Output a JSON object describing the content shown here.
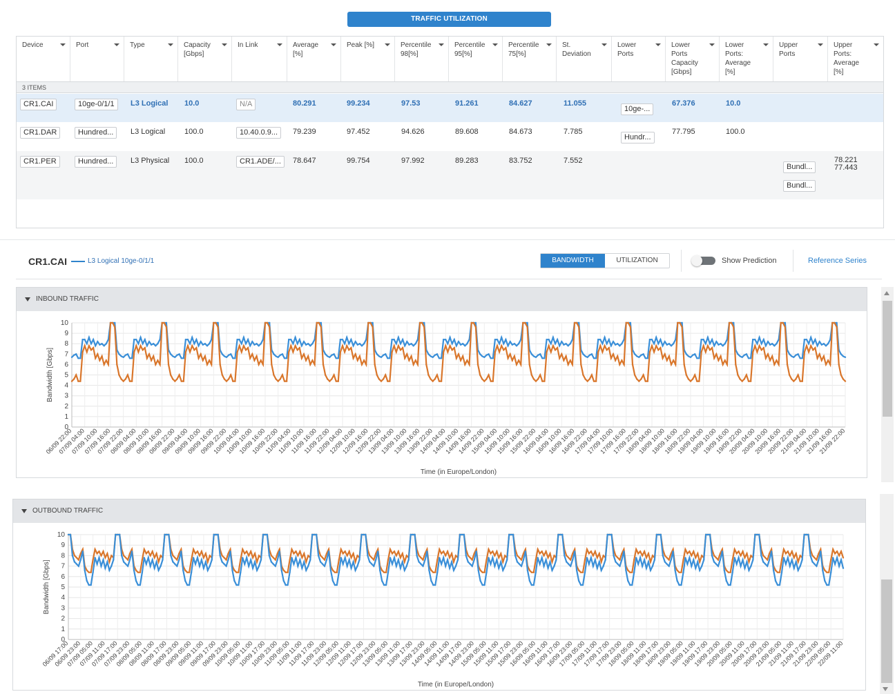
{
  "header": {
    "traffic_utilization_label": "TRAFFIC UTILIZATION"
  },
  "table": {
    "columns": [
      [
        "Device"
      ],
      [
        "Port"
      ],
      [
        "Type"
      ],
      [
        "Capacity",
        "[Gbps]"
      ],
      [
        "In Link"
      ],
      [
        "Average",
        "[%]"
      ],
      [
        "Peak [%]"
      ],
      [
        "Percentile",
        "98[%]"
      ],
      [
        "Percentile",
        "95[%]"
      ],
      [
        "Percentile",
        "75[%]"
      ],
      [
        "St.",
        "Deviation"
      ],
      [
        "Lower",
        "Ports"
      ],
      [
        "Lower",
        "Ports",
        "Capacity",
        "[Gbps]"
      ],
      [
        "Lower",
        "Ports:",
        "Average",
        "[%]"
      ],
      [
        "Upper",
        "Ports"
      ],
      [
        "Upper",
        "Ports:",
        "Average",
        "[%]"
      ]
    ],
    "group_label": "3 ITEMS",
    "rows": [
      {
        "device": "CR1.CAI",
        "port": "10ge-0/1/1",
        "type": "L3 Logical",
        "capacity": "10.0",
        "in_link": "N/A",
        "average": "80.291",
        "peak": "99.234",
        "p98": "97.53",
        "p95": "91.261",
        "p75": "84.627",
        "stdev": "11.055",
        "lower_ports": "10ge-...",
        "lower_cap": "67.376",
        "lower_avg": "10.0",
        "upper_ports": [],
        "upper_avg": ""
      },
      {
        "device": "CR1.DAR",
        "port": "Hundred...",
        "type": "L3 Logical",
        "capacity": "100.0",
        "in_link": "10.40.0.9...",
        "average": "79.239",
        "peak": "97.452",
        "p98": "94.626",
        "p95": "89.608",
        "p75": "84.673",
        "stdev": "7.785",
        "lower_ports": "Hundr...",
        "lower_cap": "77.795",
        "lower_avg": "100.0",
        "upper_ports": [],
        "upper_avg": ""
      },
      {
        "device": "CR1.PER",
        "port": "Hundred...",
        "type": "L3 Physical",
        "capacity": "100.0",
        "in_link": "CR1.ADE/...",
        "average": "78.647",
        "peak": "99.754",
        "p98": "97.992",
        "p95": "89.283",
        "p75": "83.752",
        "stdev": "7.552",
        "lower_ports": "",
        "lower_cap": "",
        "lower_avg": "",
        "upper_ports": [
          "Bundl...",
          "Bundl..."
        ],
        "upper_avg": "78.221\n77.443"
      }
    ]
  },
  "detail": {
    "device": "CR1.CAI",
    "subtitle": "L3 Logical 10ge-0/1/1",
    "tabs": [
      "BANDWIDTH",
      "UTILIZATION"
    ],
    "active_tab": "BANDWIDTH",
    "show_prediction_label": "Show Prediction",
    "show_prediction_on": false,
    "reference_series_label": "Reference Series"
  },
  "colors": {
    "accent": "#2f83cc",
    "blue_series": "#3a8fd8",
    "orange_series": "#d9762b"
  },
  "charts": [
    {
      "section_label": "INBOUND TRAFFIC",
      "chart_data": {
        "type": "line",
        "ylabel": "Bandwidth [Gbps]",
        "xlabel": "Time (in Europe/London)",
        "ylim": [
          0,
          10
        ],
        "yticks": [
          0,
          1,
          2,
          3,
          4,
          5,
          6,
          7,
          8,
          9,
          10
        ],
        "categories": [
          "06/09 22:00",
          "07/09 04:00",
          "07/09 10:00",
          "07/09 16:00",
          "07/09 22:00",
          "08/09 04:00",
          "08/09 10:00",
          "08/09 16:00",
          "08/09 22:00",
          "09/09 04:00",
          "09/09 10:00",
          "09/09 16:00",
          "09/09 22:00",
          "10/09 04:00",
          "10/09 10:00",
          "10/09 16:00",
          "10/09 22:00",
          "11/09 04:00",
          "11/09 10:00",
          "11/09 16:00",
          "11/09 22:00",
          "12/09 04:00",
          "12/09 10:00",
          "12/09 16:00",
          "12/09 22:00",
          "13/09 04:00",
          "13/09 10:00",
          "13/09 16:00",
          "13/09 22:00",
          "14/09 04:00",
          "14/09 10:00",
          "14/09 16:00",
          "14/09 22:00",
          "15/09 04:00",
          "15/09 10:00",
          "15/09 16:00",
          "15/09 22:00",
          "16/09 04:00",
          "16/09 10:00",
          "16/09 16:00",
          "16/09 22:00",
          "17/09 04:00",
          "17/09 10:00",
          "17/09 16:00",
          "17/09 22:00",
          "18/09 04:00",
          "18/09 10:00",
          "18/09 16:00",
          "18/09 22:00",
          "19/09 04:00",
          "19/09 10:00",
          "19/09 16:00",
          "19/09 22:00",
          "20/09 04:00",
          "20/09 10:00",
          "20/09 16:00",
          "20/09 22:00",
          "21/09 04:00",
          "21/09 10:00",
          "21/09 16:00",
          "21/09 22:00"
        ],
        "series": [
          {
            "color": "#3a8fd8",
            "daily_profile": [
              7.0,
              6.6,
              6.6,
              8.4,
              8.4,
              8.0,
              8.6,
              8.0,
              8.4,
              7.8,
              8.2,
              7.9,
              8.0,
              7.8,
              8.0,
              8.4,
              10,
              10,
              10,
              7.4,
              7.0,
              6.8,
              6.7,
              6.9
            ]
          },
          {
            "color": "#d9762b",
            "daily_profile": [
              5.0,
              4.4,
              4.4,
              7.2,
              7.8,
              7.2,
              7.8,
              7.4,
              7.6,
              6.6,
              7.0,
              6.4,
              6.8,
              6.0,
              6.4,
              6.0,
              10,
              10,
              9.6,
              6.0,
              5.0,
              4.6,
              4.4,
              4.6
            ]
          }
        ]
      }
    },
    {
      "section_label": "OUTBOUND TRAFFIC",
      "chart_data": {
        "type": "line",
        "ylabel": "Bandwidth [Gbps]",
        "xlabel": "Time (in Europe/London)",
        "ylim": [
          0,
          10
        ],
        "yticks": [
          0,
          1,
          2,
          3,
          4,
          5,
          6,
          7,
          8,
          9,
          10
        ],
        "categories": [
          "06/09 17:00",
          "06/09 23:00",
          "07/09 05:00",
          "07/09 11:00",
          "07/09 17:00",
          "07/09 23:00",
          "08/09 05:00",
          "08/09 11:00",
          "08/09 17:00",
          "08/09 23:00",
          "09/09 05:00",
          "09/09 11:00",
          "09/09 17:00",
          "09/09 23:00",
          "10/09 05:00",
          "10/09 11:00",
          "10/09 17:00",
          "10/09 23:00",
          "11/09 05:00",
          "11/09 11:00",
          "11/09 17:00",
          "11/09 23:00",
          "12/09 05:00",
          "12/09 11:00",
          "12/09 17:00",
          "12/09 23:00",
          "13/09 05:00",
          "13/09 11:00",
          "13/09 17:00",
          "13/09 23:00",
          "14/09 05:00",
          "14/09 11:00",
          "14/09 17:00",
          "14/09 23:00",
          "15/09 05:00",
          "15/09 11:00",
          "15/09 17:00",
          "15/09 23:00",
          "16/09 05:00",
          "16/09 11:00",
          "16/09 17:00",
          "16/09 23:00",
          "17/09 05:00",
          "17/09 11:00",
          "17/09 17:00",
          "17/09 23:00",
          "18/09 05:00",
          "18/09 11:00",
          "18/09 17:00",
          "18/09 23:00",
          "19/09 05:00",
          "19/09 11:00",
          "19/09 17:00",
          "19/09 23:00",
          "20/09 05:00",
          "20/09 11:00",
          "20/09 17:00",
          "20/09 23:00",
          "21/09 05:00",
          "21/09 11:00",
          "21/09 17:00",
          "21/09 23:00",
          "22/09 05:00",
          "22/09 11:00"
        ],
        "series": [
          {
            "color": "#d9762b",
            "daily_profile": [
              8.6,
              7.0,
              6.6,
              6.4,
              6.4,
              7.6,
              8.6,
              8.2,
              8.4,
              8.0,
              8.4,
              7.8,
              8.2,
              7.4,
              8.0,
              7.8,
              10,
              10,
              10,
              8.6,
              8.0,
              7.8,
              7.6,
              8.2
            ]
          },
          {
            "color": "#3a8fd8",
            "daily_profile": [
              8.4,
              6.6,
              5.6,
              5.2,
              5.2,
              6.4,
              7.8,
              7.2,
              7.8,
              7.0,
              7.6,
              6.8,
              7.4,
              6.6,
              7.0,
              7.6,
              10,
              10,
              10,
              8.0,
              7.4,
              7.2,
              7.0,
              7.6
            ]
          }
        ]
      }
    }
  ]
}
